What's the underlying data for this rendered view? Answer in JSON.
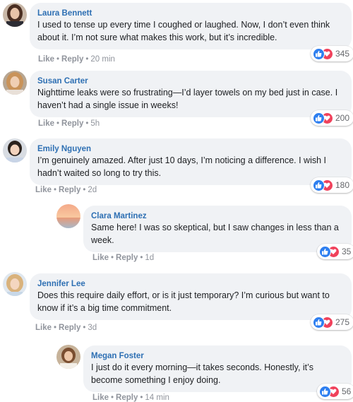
{
  "comments": [
    {
      "author": "Laura Bennett",
      "text": "I used to tense up every time I coughed or laughed. Now, I don’t even think about it. I’m not sure what makes this work, but it’s incredible.",
      "like_label": "Like",
      "reply_label": "Reply",
      "time": "20 min",
      "reactions": "345"
    },
    {
      "author": "Susan Carter",
      "text": "Nighttime leaks were so frustrating—I’d layer towels on my bed just in case. I haven’t had a single issue in weeks!",
      "like_label": "Like",
      "reply_label": "Reply",
      "time": "5h",
      "reactions": "200"
    },
    {
      "author": "Emily Nguyen",
      "text": "I’m genuinely amazed. After just 10 days, I’m noticing a difference. I wish I hadn’t waited so long to try this.",
      "like_label": "Like",
      "reply_label": "Reply",
      "time": "2d",
      "reactions": "180"
    },
    {
      "author": "Clara Martinez",
      "text": "Same here! I was so skeptical, but I saw changes in less than a week.",
      "like_label": "Like",
      "reply_label": "Reply",
      "time": "1d",
      "reactions": "35"
    },
    {
      "author": "Jennifer Lee",
      "text": "Does this require daily effort, or is it just temporary? I’m curious but want to know if it’s a big time commitment.",
      "like_label": "Like",
      "reply_label": "Reply",
      "time": "3d",
      "reactions": "275"
    },
    {
      "author": "Megan Foster",
      "text": "I just do it every morning—it takes seconds. Honestly, it’s become something I enjoy doing.",
      "like_label": "Like",
      "reply_label": "Reply",
      "time": "14 min",
      "reactions": "56"
    }
  ],
  "colors": {
    "author": "#2d6fb3",
    "bubble": "#f0f2f5",
    "like": "#2e7ff0",
    "love": "#f0415b",
    "meta": "#90949c"
  },
  "icons": [
    "like-icon",
    "heart-icon"
  ]
}
